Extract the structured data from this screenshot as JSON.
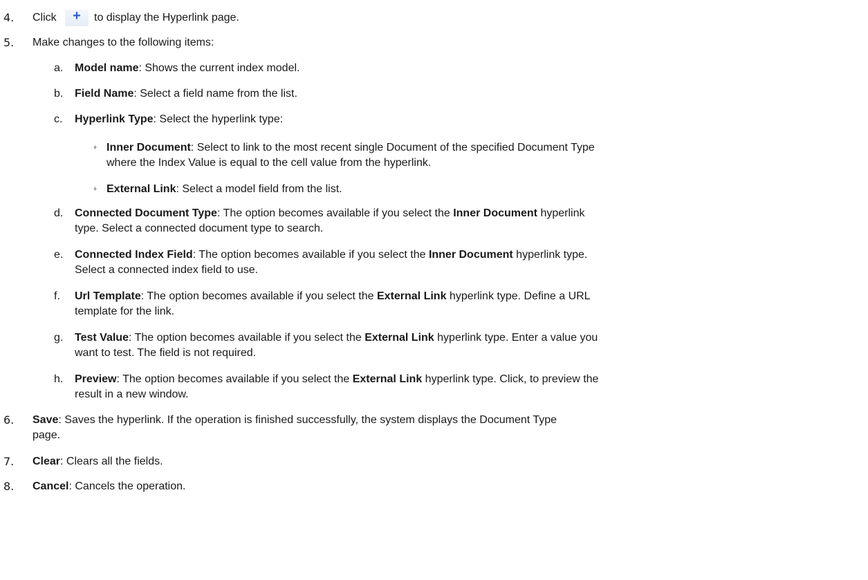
{
  "steps": {
    "s4": {
      "num": "4.",
      "before": "Click",
      "after": "to display the Hyperlink page.",
      "icon": "plus-icon"
    },
    "s5": {
      "num": "5.",
      "text": "Make changes to  the following items:"
    },
    "a": {
      "letter": "a.",
      "bold": "Model name",
      "rest": ": Shows the current index model."
    },
    "b": {
      "letter": "b.",
      "bold": "Field Name",
      "rest": ": Select a field name from the list."
    },
    "c": {
      "letter": "c.",
      "bold": "Hyperlink Type",
      "rest": ": Select the hyperlink type:"
    },
    "c1": {
      "bullet": "♦",
      "bold": "Inner Document",
      "rest1": ": Select to link to the most recent single Document of the specified Document Type",
      "line2": "where the Index Value is equal to the cell value from the hyperlink."
    },
    "c2": {
      "bullet": "♦",
      "bold": "External Link",
      "rest": ": Select a model field from the list."
    },
    "d": {
      "letter": "d.",
      "bold": "Connected Document Type",
      "rest1": ": The option becomes available if you select the ",
      "bold2": "Inner Document",
      "rest2": " hyperlink",
      "line2": "type. Select a connected document type to search."
    },
    "e": {
      "letter": "e.",
      "bold": "Connected Index Field",
      "rest1": ": The option becomes available if you select the ",
      "bold2": "Inner Document",
      "rest2": " hyperlink type.",
      "line2": "Select a connected index field to use."
    },
    "f": {
      "letter": "f.",
      "bold": "Url Template",
      "rest1": ": The option becomes available if you select the ",
      "bold2": "External Link",
      "rest2": " hyperlink type. Define a URL",
      "line2": "template for the link."
    },
    "g": {
      "letter": "g.",
      "bold": "Test Value",
      "rest1": ": The option becomes available if you select the ",
      "bold2": "External Link",
      "rest2": " hyperlink type. Enter a value you",
      "line2": "want to test. The field is not required."
    },
    "h": {
      "letter": "h.",
      "bold": "Preview",
      "rest1": ": The option becomes available if you select the ",
      "bold2": "External Link",
      "rest2": " hyperlink type. Click, to preview the",
      "line2": "result in a new window."
    },
    "s6": {
      "num": "6.",
      "bold": "Save",
      "rest": ": Saves the hyperlink. If the operation is finished successfully, the system displays the Document Type",
      "line2": "page."
    },
    "s7": {
      "num": "7.",
      "bold": "Clear",
      "rest": ": Clears all the fields."
    },
    "s8": {
      "num": "8.",
      "bold": "Cancel",
      "rest": ": Cancels the operation."
    }
  }
}
